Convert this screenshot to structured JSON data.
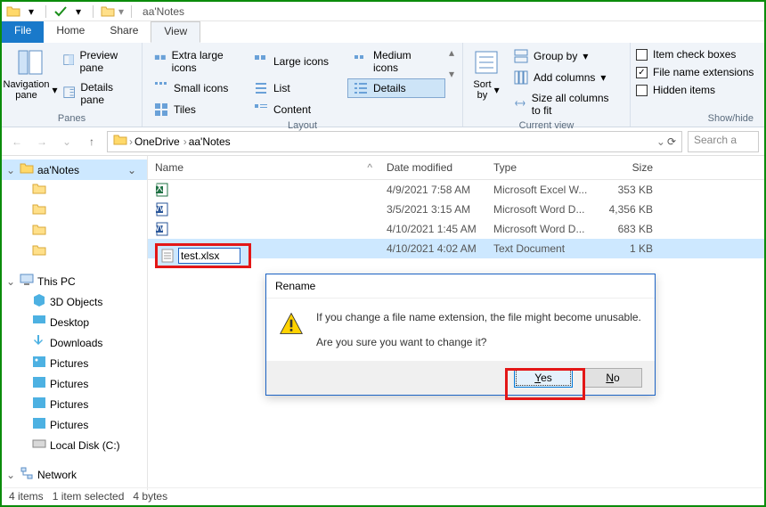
{
  "window": {
    "title": "aa'Notes"
  },
  "tabs": {
    "file": "File",
    "home": "Home",
    "share": "Share",
    "view": "View"
  },
  "ribbon": {
    "panes": {
      "nav": "Navigation pane",
      "preview": "Preview pane",
      "details": "Details pane",
      "title": "Panes"
    },
    "layout": {
      "xl": "Extra large icons",
      "large": "Large icons",
      "medium": "Medium icons",
      "small": "Small icons",
      "list": "List",
      "details": "Details",
      "tiles": "Tiles",
      "content": "Content",
      "title": "Layout"
    },
    "current": {
      "sort": "Sort by",
      "group": "Group by",
      "addcols": "Add columns",
      "sizecols": "Size all columns to fit",
      "title": "Current view"
    },
    "showhide": {
      "checkboxes": "Item check boxes",
      "ext": "File name extensions",
      "hidden": "Hidden items",
      "title": "Show/hide"
    }
  },
  "breadcrumb": {
    "a": "OneDrive",
    "b": "aa'Notes"
  },
  "search": {
    "placeholder": "Search a"
  },
  "tree": {
    "i0": "aa'Notes",
    "i1": "",
    "i2": "",
    "i3": "",
    "i4": "",
    "pc": "This PC",
    "obj": "3D Objects",
    "desk": "Desktop",
    "down": "Downloads",
    "pic1": "Pictures",
    "pic2": "Pictures",
    "pic3": "Pictures",
    "pic4": "Pictures",
    "disk": "Local Disk (C:)",
    "net": "Network"
  },
  "columns": {
    "name": "Name",
    "date": "Date modified",
    "type": "Type",
    "size": "Size"
  },
  "files": [
    {
      "name": "",
      "date": "4/9/2021 7:58 AM",
      "type": "Microsoft Excel W...",
      "size": "353 KB"
    },
    {
      "name": "",
      "date": "3/5/2021 3:15 AM",
      "type": "Microsoft Word D...",
      "size": "4,356 KB"
    },
    {
      "name": "",
      "date": "4/10/2021 1:45 AM",
      "type": "Microsoft Word D...",
      "size": "683 KB"
    },
    {
      "name": "test.xlsx",
      "date": "4/10/2021 4:02 AM",
      "type": "Text Document",
      "size": "1 KB"
    }
  ],
  "rename": {
    "value": "test.xlsx"
  },
  "dialog": {
    "title": "Rename",
    "line1": "If you change a file name extension, the file might become unusable.",
    "line2": "Are you sure you want to change it?",
    "yes": "Yes",
    "no": "No"
  },
  "status": {
    "items": "4 items",
    "selected": "1 item selected",
    "bytes": "4 bytes"
  }
}
